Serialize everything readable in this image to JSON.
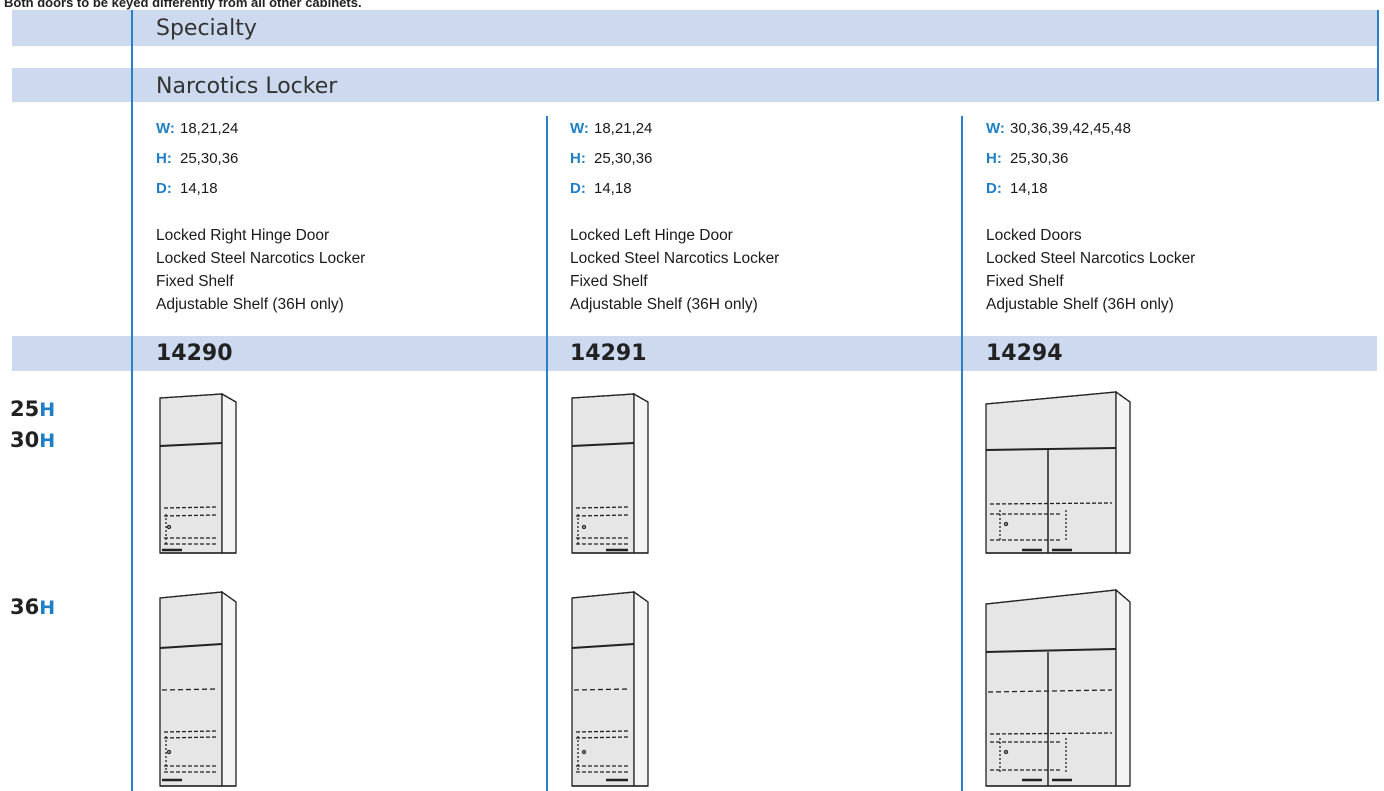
{
  "top_note": "Both doors to be keyed differently from all other cabinets.",
  "category": "Specialty",
  "product_line": "Narcotics Locker",
  "dim_labels": {
    "w": "W:",
    "h": "H:",
    "d": "D:"
  },
  "columns": [
    {
      "width": "18,21,24",
      "height": "25,30,36",
      "depth": "14,18",
      "features": [
        "Locked Right Hinge Door",
        "Locked Steel Narcotics Locker",
        "Fixed Shelf",
        "Adjustable Shelf (36H only)"
      ],
      "model": "14290"
    },
    {
      "width": "18,21,24",
      "height": "25,30,36",
      "depth": "14,18",
      "features": [
        "Locked Left Hinge Door",
        "Locked Steel Narcotics Locker",
        "Fixed Shelf",
        "Adjustable Shelf (36H only)"
      ],
      "model": "14291"
    },
    {
      "width": "30,36,39,42,45,48",
      "height": "25,30,36",
      "depth": "14,18",
      "features": [
        "Locked Doors",
        "Locked Steel Narcotics Locker",
        "Fixed Shelf",
        "Adjustable Shelf (36H only)"
      ],
      "model": "14294"
    }
  ],
  "height_rows": [
    {
      "lines": [
        {
          "num": "25",
          "unit": "H"
        },
        {
          "num": "30",
          "unit": "H"
        }
      ]
    },
    {
      "lines": [
        {
          "num": "36",
          "unit": "H"
        }
      ]
    }
  ],
  "colors": {
    "band": "#cdd9ee",
    "accent": "#1f7fc6",
    "rule": "#2a7fc8"
  },
  "illustrations": [
    "single-door-right-hinge-cabinet",
    "single-door-left-hinge-cabinet",
    "double-door-cabinet",
    "single-door-right-hinge-cabinet-tall",
    "single-door-left-hinge-cabinet-tall",
    "double-door-cabinet-tall"
  ]
}
